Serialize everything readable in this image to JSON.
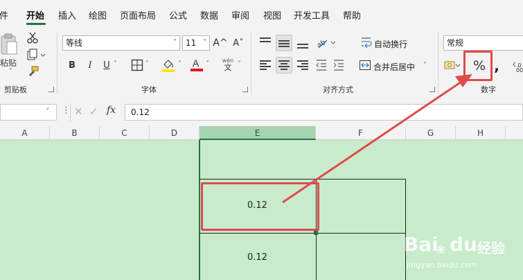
{
  "menu": {
    "items": [
      "文件",
      "开始",
      "插入",
      "绘图",
      "页面布局",
      "公式",
      "数据",
      "审阅",
      "视图",
      "开发工具",
      "帮助"
    ],
    "partial_first": "件"
  },
  "ribbon": {
    "clipboard": {
      "paste_label": "粘贴",
      "group_label": "剪贴板"
    },
    "font": {
      "name": "等线",
      "size": "11",
      "grow": "A^",
      "shrink": "A˅",
      "bold": "B",
      "italic": "I",
      "underline": "U",
      "phonetic": "wén",
      "phonetic_char": "文",
      "group_label": "字体",
      "fill_color": "#ffe600",
      "font_color": "#e81123"
    },
    "alignment": {
      "wrap_label": "自动换行",
      "merge_label": "合并后居中",
      "group_label": "对齐方式"
    },
    "number": {
      "format": "常规",
      "percent": "%",
      "comma": ",",
      "group_label": "数字"
    }
  },
  "formula_bar": {
    "fx": "fx",
    "value": "0.12"
  },
  "columns": [
    "A",
    "B",
    "C",
    "D",
    "E",
    "F",
    "G",
    "H"
  ],
  "selected_column": "E",
  "cells": {
    "e_upper": "0.12",
    "e_lower": "0.12"
  },
  "watermark": {
    "brand": "Bai",
    "brand2": "du",
    "cn": "经验",
    "url": "jingyan.baidu.com"
  },
  "colors": {
    "accent": "#217346",
    "highlight": "#e04a4a",
    "sheet_bg": "#c7ebcb"
  }
}
